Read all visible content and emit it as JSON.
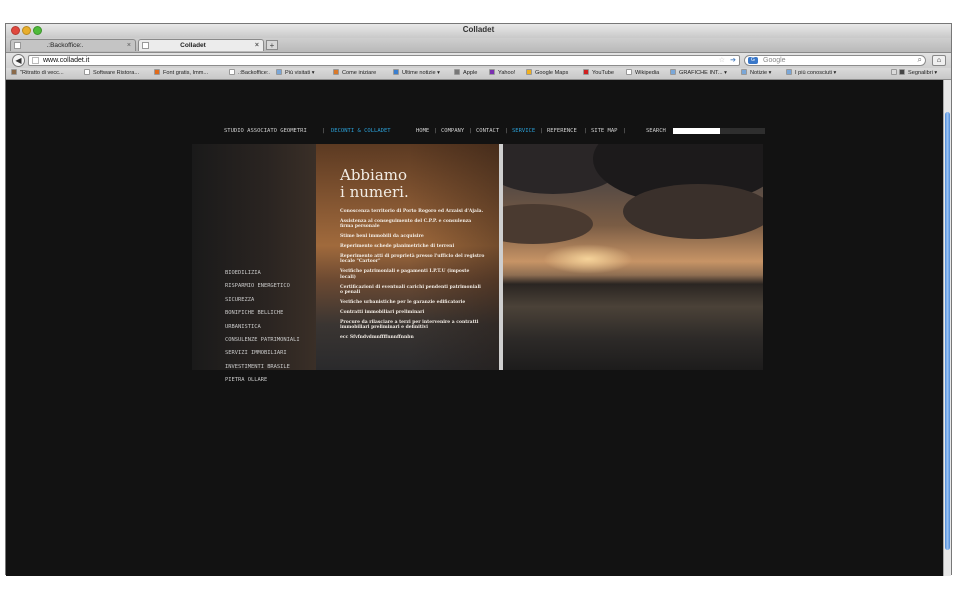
{
  "window": {
    "title": "Colladet"
  },
  "tabs": [
    {
      "label": ".:Backoffice:."
    },
    {
      "label": "Colladet"
    }
  ],
  "nav": {
    "url": "www.colladet.it",
    "search_placeholder": "Google"
  },
  "bookmarks": [
    {
      "label": "\"Ritratto di vecc...",
      "icon": "user-icon",
      "color": "#8a6a4a"
    },
    {
      "label": "Software Ristora...",
      "icon": "page-icon",
      "color": "#ffffff"
    },
    {
      "label": "Font gratis, Imm...",
      "icon": "font-site-icon",
      "color": "#e06a1a"
    },
    {
      "label": ".:Backoffice:.",
      "icon": "page-icon",
      "color": "#ffffff"
    },
    {
      "label": "Più visitati ▾",
      "icon": "folder-icon",
      "color": "#7aa7d8"
    },
    {
      "label": "Come iniziare",
      "icon": "firefox-icon",
      "color": "#d9792a"
    },
    {
      "label": "Ultime notizie ▾",
      "icon": "rss-icon",
      "color": "#3a7fd0"
    },
    {
      "label": "Apple",
      "icon": "apple-icon",
      "color": "#777777"
    },
    {
      "label": "Yahoo!",
      "icon": "yahoo-icon",
      "color": "#7a2fb0"
    },
    {
      "label": "Google Maps",
      "icon": "maps-icon",
      "color": "#f0b020"
    },
    {
      "label": "YouTube",
      "icon": "youtube-icon",
      "color": "#d02020"
    },
    {
      "label": "Wikipedia",
      "icon": "page-icon",
      "color": "#ffffff"
    },
    {
      "label": "GRAFICHE INT... ▾",
      "icon": "folder-icon",
      "color": "#7aa7d8"
    },
    {
      "label": "Notizie ▾",
      "icon": "folder-icon",
      "color": "#7aa7d8"
    },
    {
      "label": "I più conosciuti ▾",
      "icon": "folder-icon",
      "color": "#7aa7d8"
    },
    {
      "label": "» ",
      "icon": "chevrons-icon",
      "color": "#dadada"
    },
    {
      "label": "Segnalibri ▾",
      "icon": "bookmarks-icon",
      "color": "#444444"
    }
  ],
  "site": {
    "nav": {
      "studio": "STUDIO ASSOCIATO GEOMETRI",
      "sep": "|",
      "brand": "DECONTI & COLLADET",
      "home": "HOME",
      "company": "COMPANY",
      "contact": "CONTACT",
      "service": "SERVICE",
      "reference": "REFERENCE",
      "sitemap": "SITE MAP",
      "search": "SEARCH"
    },
    "menu": [
      "BIOEDILIZIA",
      "RISPARMIO ENERGETICO",
      "SICUREZZA",
      "BONIFICHE BELLICHE",
      "URBANISTICA",
      "CONSULENZE PATRIMONIALI",
      "SERVIZI IMMOBILIARI",
      "INVESTIMENTI BRASILE",
      "PIETRA OLLARE"
    ],
    "hero": {
      "title_line1": "Abbiamo",
      "title_line2": "i numeri.",
      "services": [
        "Conoscenza territorio di Porto Rogoro ed Arzaisi d'Ajala.",
        "Assistenza al conseguimento del C.P.P. e consulenza firma personale",
        "Stime beni immobili da acquisire",
        "Reperimento schede planimetriche di terreni",
        "Reperimento atti di proprietà presso l'ufficio del registro locale \"Cartoor\"",
        "Verifiche patrimoniali e pagamenti I.P.T.U (imposte locali)",
        "Certificazioni di eventuali carichi pendenti patrimoniali o penali",
        "Verifiche urbanistiche per le garanzie edificatorie",
        "Contratti immobiliari preliminari",
        "Procure da rilasciare a terzi per intervenire a contratti immobiliari preliminari e definitivi",
        "ecc Sfvfndvdmnffffnnnffnnbn"
      ]
    }
  }
}
